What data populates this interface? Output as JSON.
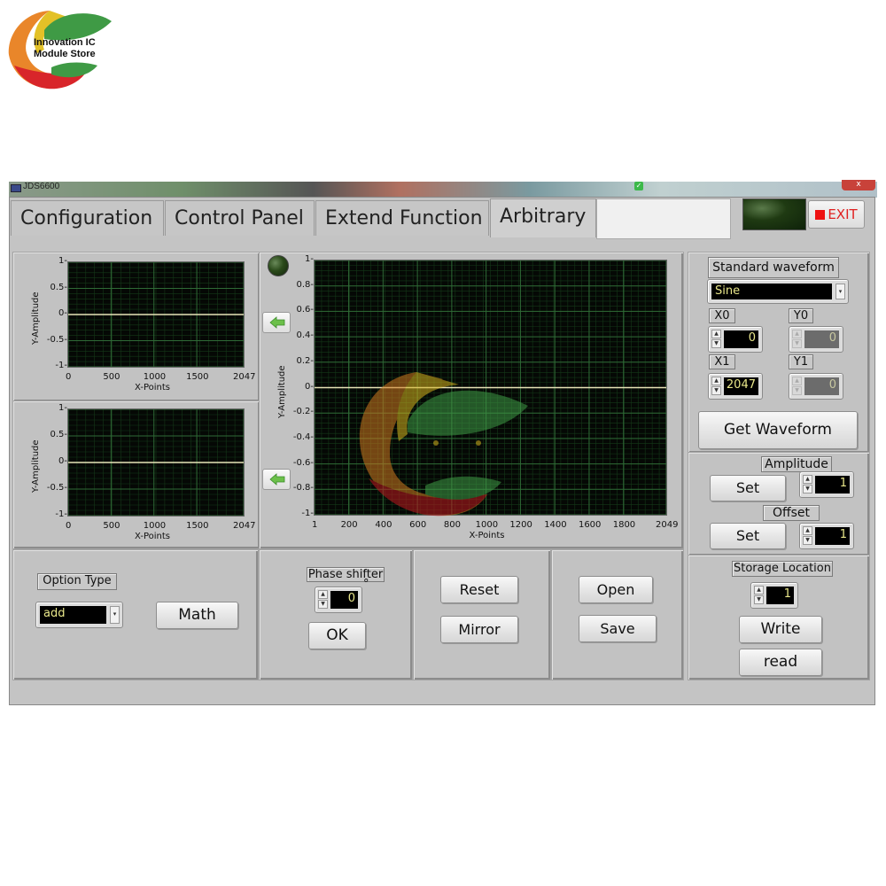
{
  "logo": {
    "line1": "Innovation IC",
    "line2": "Module Store"
  },
  "window": {
    "title": "JDS6600",
    "close_label": "x"
  },
  "tabs": [
    {
      "label": "Configuration",
      "active": false
    },
    {
      "label": "Control Panel",
      "active": false
    },
    {
      "label": "Extend Function",
      "active": false
    },
    {
      "label": "Arbitrary",
      "active": true
    }
  ],
  "exit_button": {
    "label": "EXIT",
    "color": "#ee1111"
  },
  "colors": {
    "plot_bg": "#050805",
    "grid_major": "#2f6a36",
    "grid_minor": "#143818",
    "trace": "#e8e4b8",
    "display_text": "#e9e78a"
  },
  "chart_data": [
    {
      "id": "small-graph-1",
      "type": "line",
      "xlabel": "X-Points",
      "ylabel": "Y-Amplitude",
      "xlim": [
        0,
        2047
      ],
      "ylim": [
        -1,
        1
      ],
      "xticks": [
        "0",
        "500",
        "1000",
        "1500",
        "2047"
      ],
      "yticks": [
        "1",
        "0.5",
        "0",
        "-0.5",
        "-1"
      ],
      "xtick_values": [
        0,
        500,
        1000,
        1500,
        2047
      ],
      "ytick_values": [
        1,
        0.5,
        0,
        -0.5,
        -1
      ],
      "grid": true,
      "series": [
        {
          "name": "waveform",
          "x": [
            0,
            2047
          ],
          "y": [
            0,
            0
          ]
        }
      ]
    },
    {
      "id": "small-graph-2",
      "type": "line",
      "xlabel": "X-Points",
      "ylabel": "Y-Amplitude",
      "xlim": [
        0,
        2047
      ],
      "ylim": [
        -1,
        1
      ],
      "xticks": [
        "0",
        "500",
        "1000",
        "1500",
        "2047"
      ],
      "yticks": [
        "1",
        "0.5",
        "0",
        "-0.5",
        "-1"
      ],
      "xtick_values": [
        0,
        500,
        1000,
        1500,
        2047
      ],
      "ytick_values": [
        1,
        0.5,
        0,
        -0.5,
        -1
      ],
      "grid": true,
      "series": [
        {
          "name": "waveform",
          "x": [
            0,
            2047
          ],
          "y": [
            0,
            0
          ]
        }
      ]
    },
    {
      "id": "main-graph",
      "type": "line",
      "xlabel": "X-Points",
      "ylabel": "Y-Amplitude",
      "xlim": [
        1,
        2049
      ],
      "ylim": [
        -1,
        1
      ],
      "xticks": [
        "1",
        "200",
        "400",
        "600",
        "800",
        "1000",
        "1200",
        "1400",
        "1600",
        "1800",
        "2049"
      ],
      "yticks": [
        "1",
        "0.8",
        "0.6",
        "0.4",
        "0.2",
        "0",
        "-0.2",
        "-0.4",
        "-0.6",
        "-0.8",
        "-1"
      ],
      "xtick_values": [
        1,
        200,
        400,
        600,
        800,
        1000,
        1200,
        1400,
        1600,
        1800,
        2049
      ],
      "ytick_values": [
        1,
        0.8,
        0.6,
        0.4,
        0.2,
        0,
        -0.2,
        -0.4,
        -0.6,
        -0.8,
        -1
      ],
      "grid": true,
      "series": [
        {
          "name": "waveform",
          "x": [
            1,
            2049
          ],
          "y": [
            0,
            0
          ]
        }
      ]
    }
  ],
  "right_panel": {
    "standard_waveform_label": "Standard waveform",
    "standard_waveform_value": "Sine",
    "x0_label": "X0",
    "x0_value": "0",
    "y0_label": "Y0",
    "y0_value": "0",
    "x1_label": "X1",
    "x1_value": "2047",
    "y1_label": "Y1",
    "y1_value": "0",
    "get_waveform_label": "Get Waveform",
    "amplitude_label": "Amplitude",
    "amplitude_set_label": "Set",
    "amplitude_value": "1",
    "offset_label": "Offset",
    "offset_set_label": "Set",
    "offset_value": "1",
    "storage_label": "Storage Location",
    "storage_value": "1",
    "write_label": "Write",
    "read_label": "read"
  },
  "bottom": {
    "option_type_label": "Option Type",
    "option_type_value": "add",
    "math_label": "Math",
    "phase_label": "Phase shifter",
    "phase_value": "0",
    "phase_unit": "°",
    "ok_label": "OK",
    "reset_label": "Reset",
    "mirror_label": "Mirror",
    "open_label": "Open",
    "save_label": "Save"
  }
}
